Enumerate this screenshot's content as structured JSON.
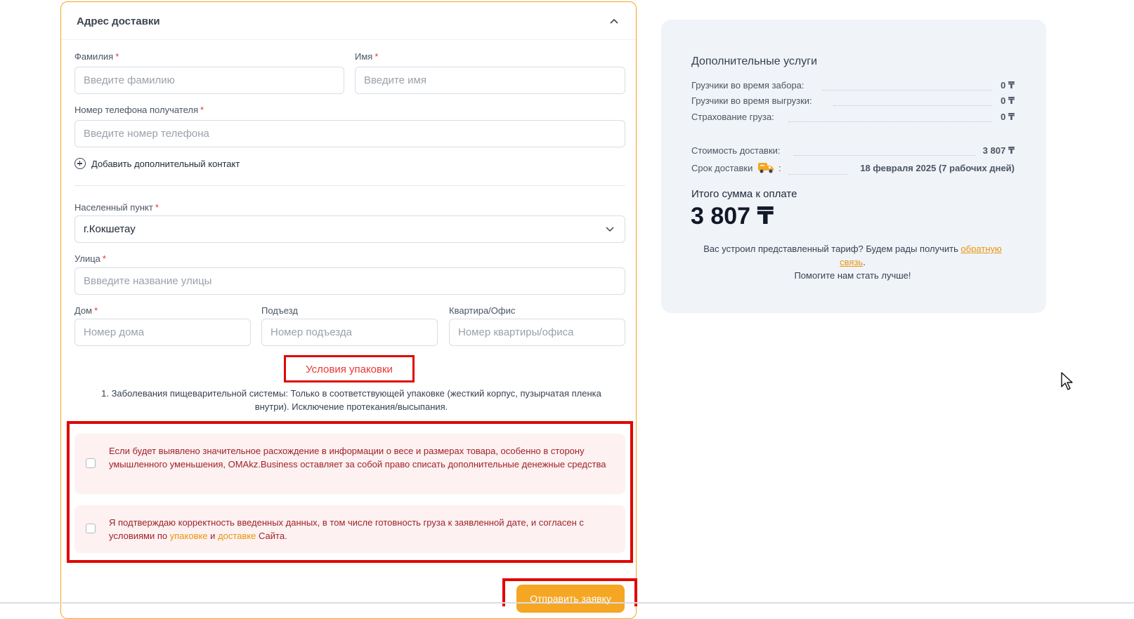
{
  "delivery_address": {
    "title": "Адрес доставки",
    "fields": {
      "last_name": {
        "label": "Фамилия",
        "required": "*",
        "placeholder": "Введите фамилию"
      },
      "first_name": {
        "label": "Имя",
        "required": "*",
        "placeholder": "Введите имя"
      },
      "phone": {
        "label": "Номер телефона получателя",
        "required": "*",
        "placeholder": "Введите номер телефона"
      },
      "city": {
        "label": "Населенный пункт",
        "required": "*",
        "value": "г.Кокшетау"
      },
      "street": {
        "label": "Улица",
        "required": "*",
        "placeholder": "Ввведите название улицы"
      },
      "house": {
        "label": "Дом",
        "required": "*",
        "placeholder": "Номер дома"
      },
      "entrance": {
        "label": "Подъезд",
        "placeholder": "Номер подъезда"
      },
      "apartment": {
        "label": "Квартира/Офис",
        "placeholder": "Номер квартиры/офиса"
      }
    },
    "add_contact_label": "Добавить дополнительный контакт"
  },
  "packaging": {
    "title": "Условия упаковки",
    "text": "1. Заболевания пищеварительной системы: Только в соответствующей упаковке (жесткий корпус, пузырчатая пленка внутри). Исключение протекания/высыпания."
  },
  "agreements": {
    "weight_notice": "Если будет выявлено значительное расхождение в информации о весе и размерах товара, особенно в сторону умышленного уменьшения, OMAkz.Business оставляет за собой право списать дополнительные денежные средства",
    "confirm_prefix": "Я подтверждаю корректность введенных данных, в том числе готовность груза к заявленной дате, и согласен с условиями по",
    "confirm_link_packaging": "упаковке",
    "confirm_and": "и",
    "confirm_link_delivery": "доставке",
    "confirm_suffix": "Сайта."
  },
  "submit_label": "Отправить заявку",
  "summary": {
    "additional_services_title": "Дополнительные услуги",
    "services": [
      {
        "label": "Грузчики во время забора:",
        "value": "0 ₸"
      },
      {
        "label": "Грузчики во время выгрузки:",
        "value": "0 ₸"
      },
      {
        "label": "Страхование груза:",
        "value": "0 ₸"
      }
    ],
    "delivery_cost": {
      "label": "Стоимость доставки:",
      "value": "3 807 ₸"
    },
    "delivery_time": {
      "label": "Срок доставки",
      "colon": ":",
      "value": "18 февраля 2025 (7 рабочих дней)"
    },
    "total_label": "Итого сумма к оплате",
    "total_value": "3 807 ₸",
    "feedback_prefix": "Вас устроил представленный тариф? Будем рады получить",
    "feedback_link": "обратную связь",
    "feedback_dot": ".",
    "feedback_suffix": "Помогите нам стать лучше!"
  },
  "colors": {
    "accent": "#f5a623",
    "highlight_red": "#e10600",
    "agreement_bg": "#fdf1f1",
    "summary_bg": "#f0f3f8"
  }
}
